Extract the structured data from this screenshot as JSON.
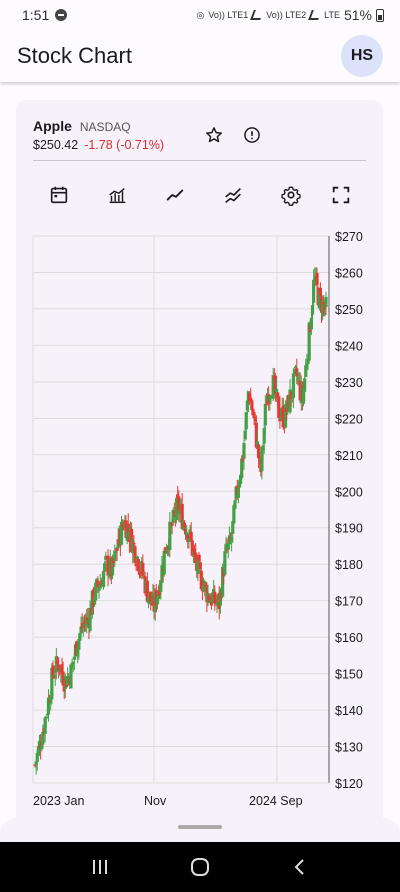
{
  "status_bar": {
    "time": "1:51",
    "battery": "51%",
    "sim1": "Vo)) LTE1",
    "sim2": "Vo)) LTE2",
    "lte": "LTE"
  },
  "app_bar": {
    "title": "Stock Chart",
    "avatar_initials": "HS"
  },
  "ticker": {
    "symbol": "Apple",
    "exchange": "NASDAQ",
    "price": "$250.42",
    "change": "-1.78 (-0.71%)"
  },
  "toolbar": {
    "icons": [
      "calendar-icon",
      "candlestick-chart-icon",
      "line-chart-icon",
      "compare-icon",
      "settings-icon",
      "fullscreen-icon"
    ]
  },
  "colors": {
    "up": "#43a047",
    "down": "#e53935",
    "grid": "#dcdcdc",
    "change_negative": "#d32f2f"
  },
  "chart_data": {
    "type": "candlestick",
    "y_ticks": [
      "$270",
      "$260",
      "$250",
      "$240",
      "$230",
      "$220",
      "$210",
      "$200",
      "$190",
      "$180",
      "$170",
      "$160",
      "$150",
      "$140",
      "$130",
      "$120"
    ],
    "ylim": [
      120,
      270
    ],
    "x_ticks": [
      "2023 Jan",
      "Nov",
      "2024 Sep"
    ],
    "grid": true,
    "series": [
      {
        "values": [
          125,
          132,
          140,
          150,
          153,
          148,
          150,
          158,
          163,
          165,
          172,
          175,
          180,
          178,
          186,
          192,
          188,
          183,
          178,
          172,
          168,
          175,
          185,
          190,
          196,
          192,
          188,
          180,
          176,
          172,
          170,
          169,
          182,
          186,
          200,
          210,
          228,
          218,
          205,
          226,
          230,
          222,
          220,
          226,
          232,
          225,
          240,
          258,
          252,
          250
        ]
      }
    ]
  }
}
